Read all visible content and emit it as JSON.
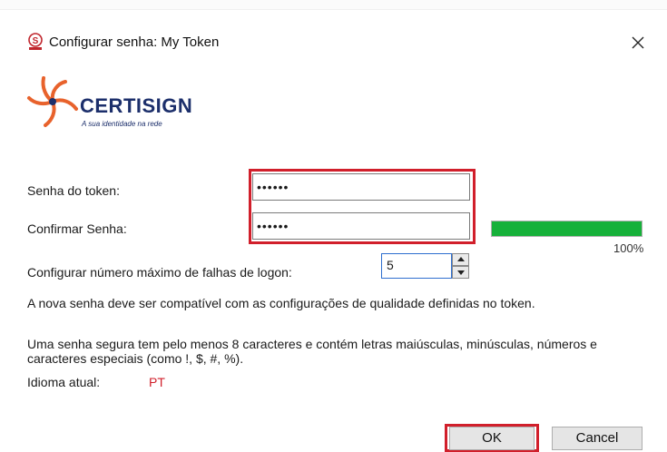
{
  "window": {
    "title": "Configurar senha: My Token"
  },
  "logo": {
    "brand": "CERTISIGN",
    "tagline": "A sua identidade na rede"
  },
  "form": {
    "token_password_label": "Senha do token:",
    "token_password_value": "••••••",
    "confirm_password_label": "Confirmar Senha:",
    "confirm_password_value": "••••••",
    "strength_percent_label": "100%",
    "strength_fraction": 1.0,
    "max_failures_label": "Configurar número máximo de falhas de logon:",
    "max_failures_value": "5"
  },
  "notes": {
    "quality": "A nova senha deve ser compatível com as configurações de qualidade definidas no token.",
    "secure": "Uma senha segura tem pelo menos 8 caracteres e contém letras maiúsculas, minúsculas, números e caracteres especiais (como !, $, #, %)."
  },
  "language": {
    "label": "Idioma atual:",
    "value": "PT"
  },
  "buttons": {
    "ok": "OK",
    "cancel": "Cancel"
  },
  "colors": {
    "highlight": "#d11f2b",
    "strength": "#16b13a",
    "brand": "#1c2f6b",
    "logo_accent": "#e8622c"
  },
  "icons": {
    "app": "certisign-s-icon",
    "close": "close-icon",
    "spin_up": "chevron-up-icon",
    "spin_down": "chevron-down-icon"
  }
}
